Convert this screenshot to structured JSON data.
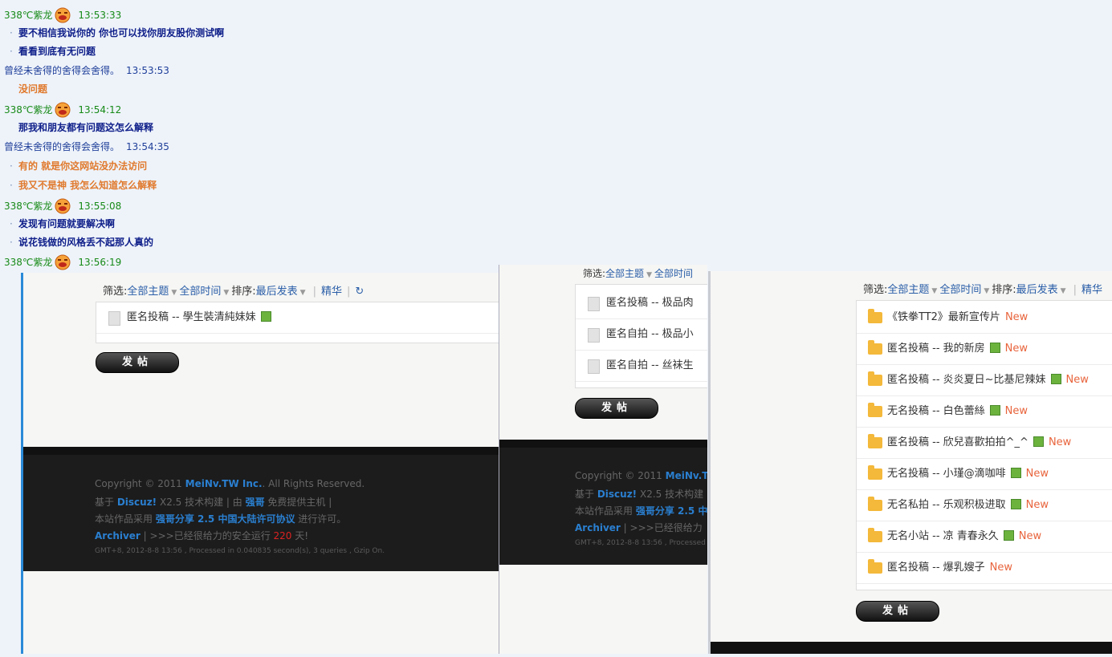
{
  "chat": {
    "entries": [
      {
        "user": "338℃紫龙",
        "time": "13:53:33"
      },
      {
        "text": "要不相信我说你的 你也可以找你朋友股你测试啊"
      },
      {
        "text": "看看到底有无问题"
      },
      {
        "user": "曾经未舍得的舍得会舍得。",
        "time": "13:53:53"
      },
      {
        "text": "没问题"
      },
      {
        "user": "338℃紫龙",
        "time": "13:54:12"
      },
      {
        "text": "那我和朋友都有问题这怎么解释"
      },
      {
        "user": "曾经未舍得的舍得会舍得。",
        "time": "13:54:35"
      },
      {
        "text": "有的 就是你这网站没办法访问"
      },
      {
        "text": "我又不是神 我怎么知道怎么解释"
      },
      {
        "user": "338℃紫龙",
        "time": "13:55:08"
      },
      {
        "text": "发现有问题就要解决啊"
      },
      {
        "text": "说花钱做的风格丢不起那人真的"
      },
      {
        "user": "338℃紫龙",
        "time": "13:56:19"
      }
    ]
  },
  "panel1": {
    "filter": {
      "label": "筛选:",
      "all_topics": "全部主题",
      "all_time": "全部时间",
      "sort_label": "排序:",
      "sort_value": "最后发表",
      "digest": "精华",
      "refresh": "↻"
    },
    "rows": [
      {
        "title": "匿名投稿 -- 學生裝清純妹妹"
      }
    ],
    "post_button": "发帖",
    "footer": {
      "l1a": "Copyright © 2011 ",
      "l1b": "MeiNv.TW Inc.",
      "l1c": ". All Rights Reserved.",
      "l2a": "基于 ",
      "l2b": "Discuz!",
      "l2c": " X2.5 技术构建 | 由 ",
      "l2d": "强哥",
      "l2e": " 免费提供主机 |",
      "l3a": "本站作品采用 ",
      "l3b": "强哥分享 2.5 中国大陆许可协议",
      "l3c": " 进行许可。",
      "l4a": "Archiver",
      "l4b": " | >>>已经很给力的安全运行 ",
      "l4c": "220",
      "l4d": " 天!",
      "l5": "GMT+8, 2012-8-8 13:56 , Processed in 0.040835 second(s), 3 queries , Gzip On."
    }
  },
  "panel2": {
    "filter_a": "筛选:",
    "filter_b": "全部主题",
    "filter_c": "全部时间",
    "rows": [
      {
        "title": "匿名投稿 -- 极品肉"
      },
      {
        "title": "匿名自拍 -- 极品小"
      },
      {
        "title": "匿名自拍 -- 丝袜生"
      }
    ],
    "post_button": "发帖",
    "footer": {
      "l1a": "Copyright © 2011 ",
      "l1b": "MeiNv.T",
      "l2a": "基于 ",
      "l2b": "Discuz!",
      "l2c": " X2.5 技术构建",
      "l3a": "本站作品采用 ",
      "l3b": "强哥分享 2.5 中",
      "l4a": "Archiver",
      "l4b": " | >>>已经很给力",
      "l5": "GMT+8, 2012-8-8 13:56 , Processed"
    }
  },
  "panel3": {
    "filter": {
      "label": "筛选:",
      "all_topics": "全部主题",
      "all_time": "全部时间",
      "sort_label": "排序:",
      "sort_value": "最后发表",
      "digest": "精华"
    },
    "rows": [
      {
        "title": "《铁拳TT2》最新宣传片",
        "img": false
      },
      {
        "title": "匿名投稿 -- 我的新房",
        "img": true
      },
      {
        "title": "匿名投稿 -- 炎炎夏日~比基尼辣妹",
        "img": true
      },
      {
        "title": "无名投稿 -- 白色蕾絲",
        "img": true
      },
      {
        "title": "匿名投稿 -- 欣兒喜歡拍拍^_^",
        "img": true
      },
      {
        "title": "无名投稿 -- 小瑾@滴咖啡",
        "img": true
      },
      {
        "title": "无名私拍 -- 乐观积极进取",
        "img": true
      },
      {
        "title": "无名小站 -- 凉 青春永久",
        "img": true
      },
      {
        "title": "匿名投稿 -- 爆乳嫂子",
        "img": false
      }
    ],
    "new_label": "New",
    "post_button": "发帖"
  }
}
